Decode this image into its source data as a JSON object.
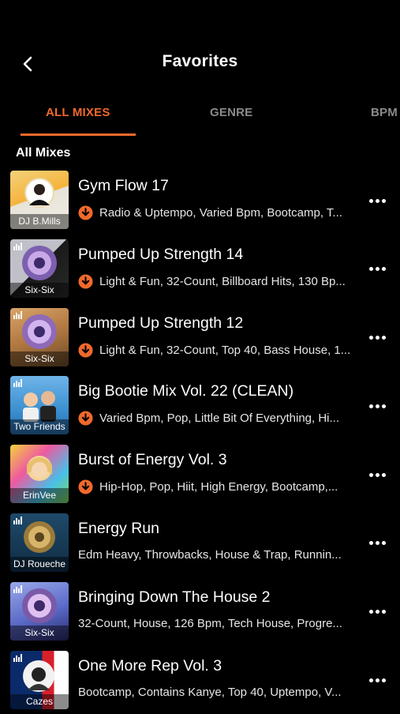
{
  "header": {
    "title": "Favorites"
  },
  "tabs": [
    {
      "label": "ALL MIXES",
      "active": true
    },
    {
      "label": "GENRE",
      "active": false
    },
    {
      "label": "BPM",
      "active": false
    }
  ],
  "section_title": "All Mixes",
  "colors": {
    "accent": "#f0692c",
    "background": "#000000"
  },
  "mixes": [
    {
      "title": "Gym Flow 17",
      "subtitle": "Radio & Uptempo, Varied Bpm, Bootcamp, T...",
      "downloaded": true,
      "artist_label": "DJ B.Mills"
    },
    {
      "title": "Pumped Up Strength 14",
      "subtitle": "Light & Fun, 32-Count, Billboard Hits, 130 Bp...",
      "downloaded": true,
      "artist_label": "Six-Six"
    },
    {
      "title": "Pumped Up Strength 12",
      "subtitle": "Light & Fun, 32-Count, Top 40, Bass House, 1...",
      "downloaded": true,
      "artist_label": "Six-Six"
    },
    {
      "title": "Big Bootie Mix Vol. 22 (CLEAN)",
      "subtitle": "Varied Bpm, Pop, Little Bit Of Everything, Hi...",
      "downloaded": true,
      "artist_label": "Two Friends"
    },
    {
      "title": "Burst of Energy Vol. 3",
      "subtitle": "Hip-Hop, Pop, Hiit, High Energy, Bootcamp,...",
      "downloaded": true,
      "artist_label": "ErinVee"
    },
    {
      "title": "Energy Run",
      "subtitle": "Edm Heavy, Throwbacks, House & Trap, Runnin...",
      "downloaded": false,
      "artist_label": "DJ Roueche"
    },
    {
      "title": "Bringing Down The House 2",
      "subtitle": "32-Count, House, 126 Bpm, Tech House, Progre...",
      "downloaded": false,
      "artist_label": "Six-Six"
    },
    {
      "title": "One More Rep Vol. 3",
      "subtitle": "Bootcamp, Contains Kanye, Top 40, Uptempo, V...",
      "downloaded": false,
      "artist_label": "Cazes"
    }
  ]
}
